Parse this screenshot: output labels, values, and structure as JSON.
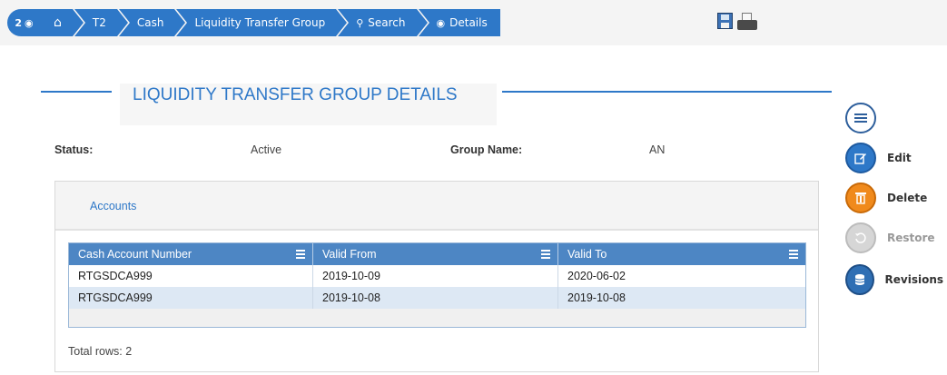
{
  "breadcrumb": {
    "badge_count": "2",
    "items": [
      {
        "label": "T2"
      },
      {
        "label": "Cash"
      },
      {
        "label": "Liquidity Transfer Group"
      },
      {
        "label": "Search"
      },
      {
        "label": "Details"
      }
    ]
  },
  "page": {
    "title": "LIQUIDITY TRANSFER GROUP DETAILS"
  },
  "fields": {
    "status_label": "Status:",
    "status_value": "Active",
    "group_name_label": "Group Name:",
    "group_name_value": "AN"
  },
  "panel": {
    "tab_label": "Accounts",
    "columns": [
      "Cash Account Number",
      "Valid From",
      "Valid To"
    ],
    "rows": [
      [
        "RTGSDCA999",
        "2019-10-09",
        "2020-06-02"
      ],
      [
        "RTGSDCA999",
        "2019-10-08",
        "2019-10-08"
      ]
    ],
    "total_rows": "Total rows: 2"
  },
  "actions": {
    "edit": "Edit",
    "delete": "Delete",
    "restore": "Restore",
    "revisions": "Revisions"
  },
  "colors": {
    "accent": "#2e78c8",
    "delete": "#f08a1c",
    "disabled": "#d6d6d6"
  }
}
